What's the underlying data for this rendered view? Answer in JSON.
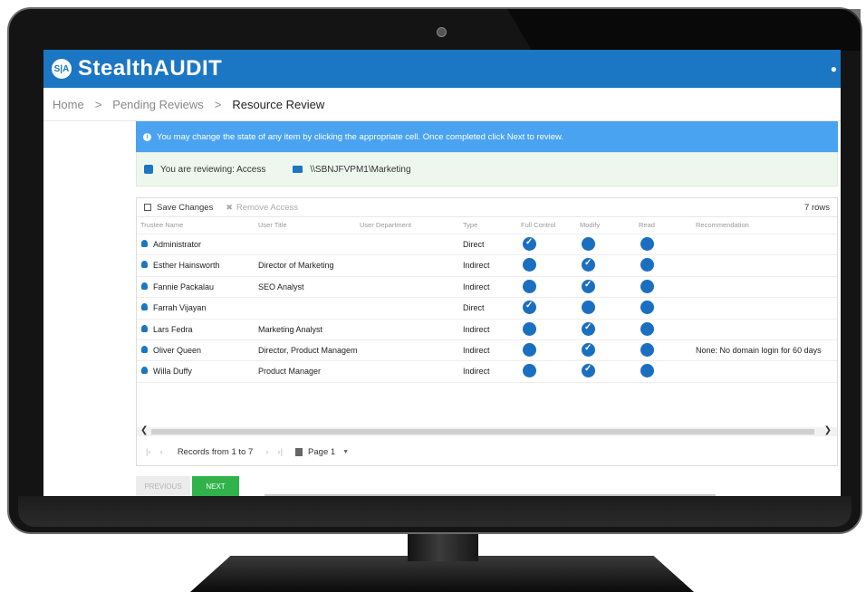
{
  "app": {
    "logo_mark": "S|A",
    "name": "StealthAUDIT"
  },
  "breadcrumb": {
    "items": [
      "Home",
      "Pending Reviews",
      "Resource Review"
    ],
    "separator": ">"
  },
  "banner": {
    "info": "You may change the state of any item by clicking the appropriate cell. Once completed click Next to review."
  },
  "review": {
    "reviewing_label": "You are reviewing: Access",
    "path": "\\\\SBNJFVPM1\\Marketing"
  },
  "toolbar": {
    "save_label": "Save Changes",
    "remove_label": "Remove Access",
    "row_count": "7 rows"
  },
  "columns": [
    "Trustee Name",
    "User Title",
    "User Department",
    "Type",
    "Full Control",
    "Modify",
    "Read",
    "Recommendation"
  ],
  "rows": [
    {
      "name": "Administrator",
      "title": "",
      "department": "",
      "type": "Direct",
      "full_control_checked": true,
      "modify_checked": false,
      "read_checked": false,
      "recommendation": ""
    },
    {
      "name": "Esther Hainsworth",
      "title": "Director of Marketing",
      "department": "",
      "type": "Indirect",
      "full_control_checked": false,
      "modify_checked": true,
      "read_checked": false,
      "recommendation": ""
    },
    {
      "name": "Fannie Packalau",
      "title": "SEO Analyst",
      "department": "",
      "type": "Indirect",
      "full_control_checked": false,
      "modify_checked": true,
      "read_checked": false,
      "recommendation": ""
    },
    {
      "name": "Farrah Vijayan",
      "title": "",
      "department": "",
      "type": "Direct",
      "full_control_checked": true,
      "modify_checked": false,
      "read_checked": false,
      "recommendation": ""
    },
    {
      "name": "Lars Fedra",
      "title": "Marketing Analyst",
      "department": "",
      "type": "Indirect",
      "full_control_checked": false,
      "modify_checked": true,
      "read_checked": false,
      "recommendation": ""
    },
    {
      "name": "Oliver Queen",
      "title": "Director, Product Managem",
      "department": "",
      "type": "Indirect",
      "full_control_checked": false,
      "modify_checked": true,
      "read_checked": false,
      "recommendation": "None: No domain login for 60 days"
    },
    {
      "name": "Willa Duffy",
      "title": "Product Manager",
      "department": "",
      "type": "Indirect",
      "full_control_checked": false,
      "modify_checked": true,
      "read_checked": false,
      "recommendation": ""
    }
  ],
  "pager": {
    "records": "Records from 1 to 7",
    "page": "Page 1"
  },
  "buttons": {
    "previous": "PREVIOUS",
    "next": "NEXT"
  },
  "colors": {
    "brand_blue": "#1b76c4",
    "banner_blue": "#4aa3f0",
    "next_green": "#2fb34a",
    "review_bg": "#eef7ee"
  }
}
